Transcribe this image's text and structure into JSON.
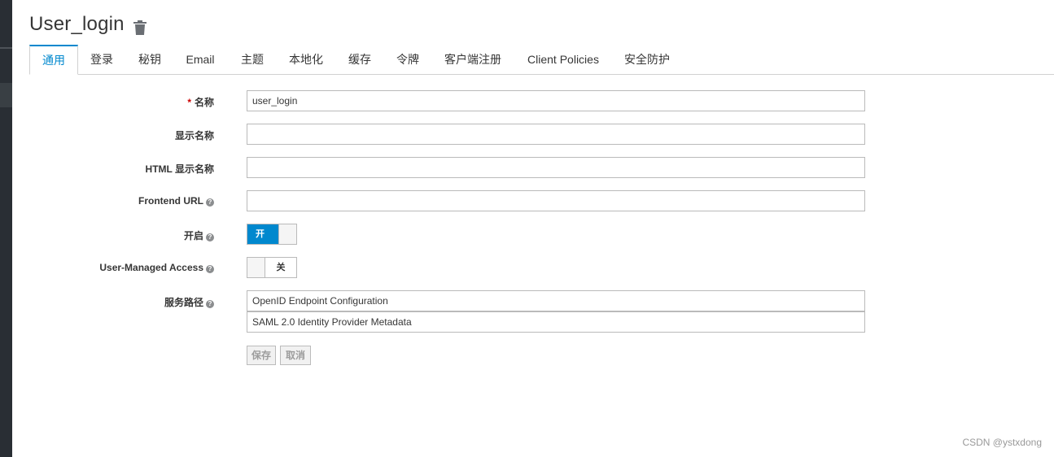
{
  "page": {
    "title": "User_login"
  },
  "tabs": [
    {
      "label": "通用",
      "active": true
    },
    {
      "label": "登录"
    },
    {
      "label": "秘钥"
    },
    {
      "label": "Email"
    },
    {
      "label": "主题"
    },
    {
      "label": "本地化"
    },
    {
      "label": "缓存"
    },
    {
      "label": "令牌"
    },
    {
      "label": "客户端注册"
    },
    {
      "label": "Client Policies"
    },
    {
      "label": "安全防护"
    }
  ],
  "form": {
    "name": {
      "required_mark": "*",
      "label": "名称",
      "value": "user_login"
    },
    "display_name": {
      "label": "显示名称",
      "value": ""
    },
    "html_display_name": {
      "label": "HTML 显示名称",
      "value": ""
    },
    "frontend_url": {
      "label": "Frontend URL",
      "value": ""
    },
    "enabled": {
      "label": "开启",
      "state_text": "开",
      "on": true
    },
    "user_managed_access": {
      "label": "User-Managed Access",
      "state_text": "关",
      "on": false
    },
    "endpoints": {
      "label": "服务路径",
      "items": [
        "OpenID Endpoint Configuration",
        "SAML 2.0 Identity Provider Metadata"
      ]
    },
    "buttons": {
      "save": "保存",
      "cancel": "取消"
    }
  },
  "help_glyph": "?",
  "watermark": "CSDN @ystxdong",
  "icons": {
    "delete": "trash-icon",
    "help": "question-circle-icon"
  },
  "colors": {
    "accent": "#0088ce",
    "sidebar": "#292e34",
    "required": "#cc0000"
  }
}
